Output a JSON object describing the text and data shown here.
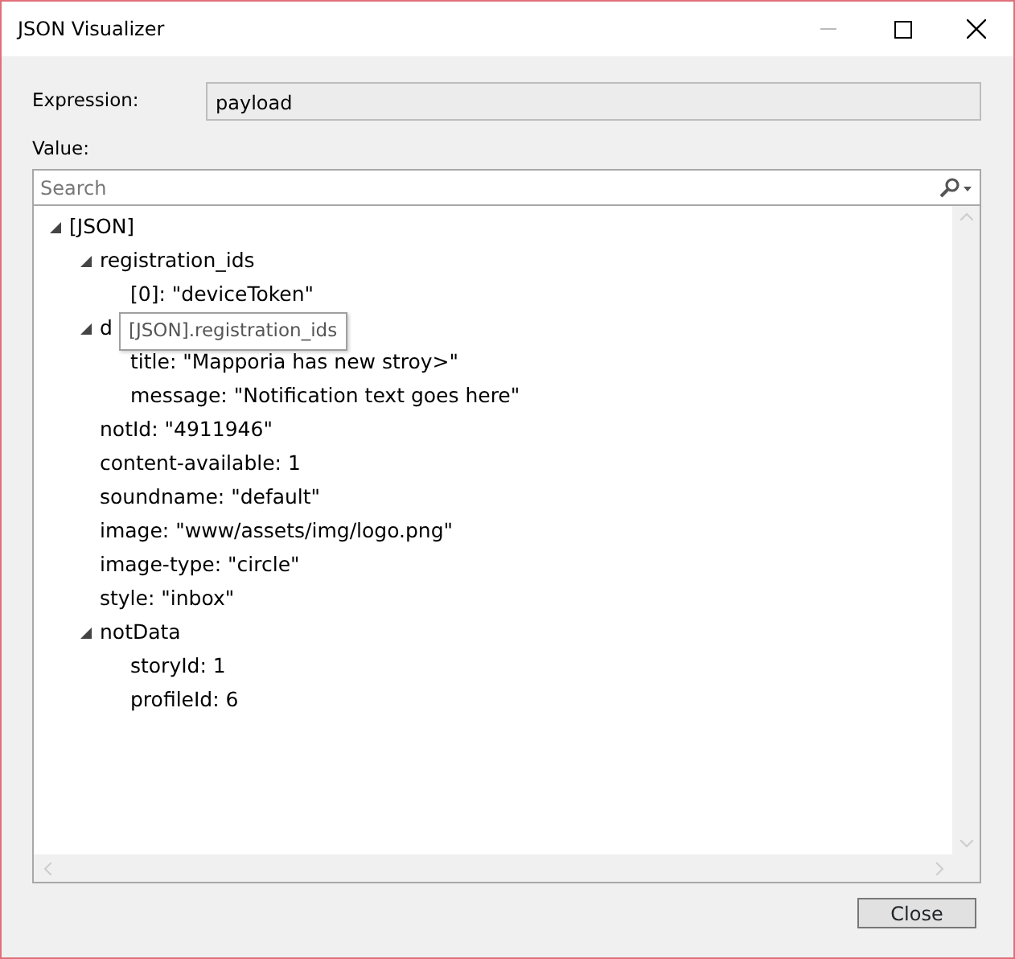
{
  "window": {
    "title": "JSON Visualizer"
  },
  "expression": {
    "label": "Expression:",
    "value": "payload"
  },
  "value_label": "Value:",
  "search": {
    "placeholder": "Search"
  },
  "tree": [
    {
      "label": "[JSON]",
      "expanded": true,
      "children": [
        {
          "label": "registration_ids",
          "expanded": true,
          "children": [
            {
              "label": "[0]: \"deviceToken\""
            }
          ]
        },
        {
          "label": "d",
          "expanded": true,
          "children": [
            {
              "label": "title: \"Mapporia has new stroy>\""
            },
            {
              "label": "message: \"Notification text goes here\""
            }
          ]
        },
        {
          "label": "notId: \"4911946\""
        },
        {
          "label": "content-available: 1"
        },
        {
          "label": "soundname: \"default\""
        },
        {
          "label": "image: \"www/assets/img/logo.png\""
        },
        {
          "label": "image-type: \"circle\""
        },
        {
          "label": "style: \"inbox\""
        },
        {
          "label": "notData",
          "expanded": true,
          "children": [
            {
              "label": "storyId: 1"
            },
            {
              "label": "profileId: 6"
            }
          ]
        }
      ]
    }
  ],
  "tooltip": "[JSON].registration_ids",
  "buttons": [
    "Close"
  ]
}
